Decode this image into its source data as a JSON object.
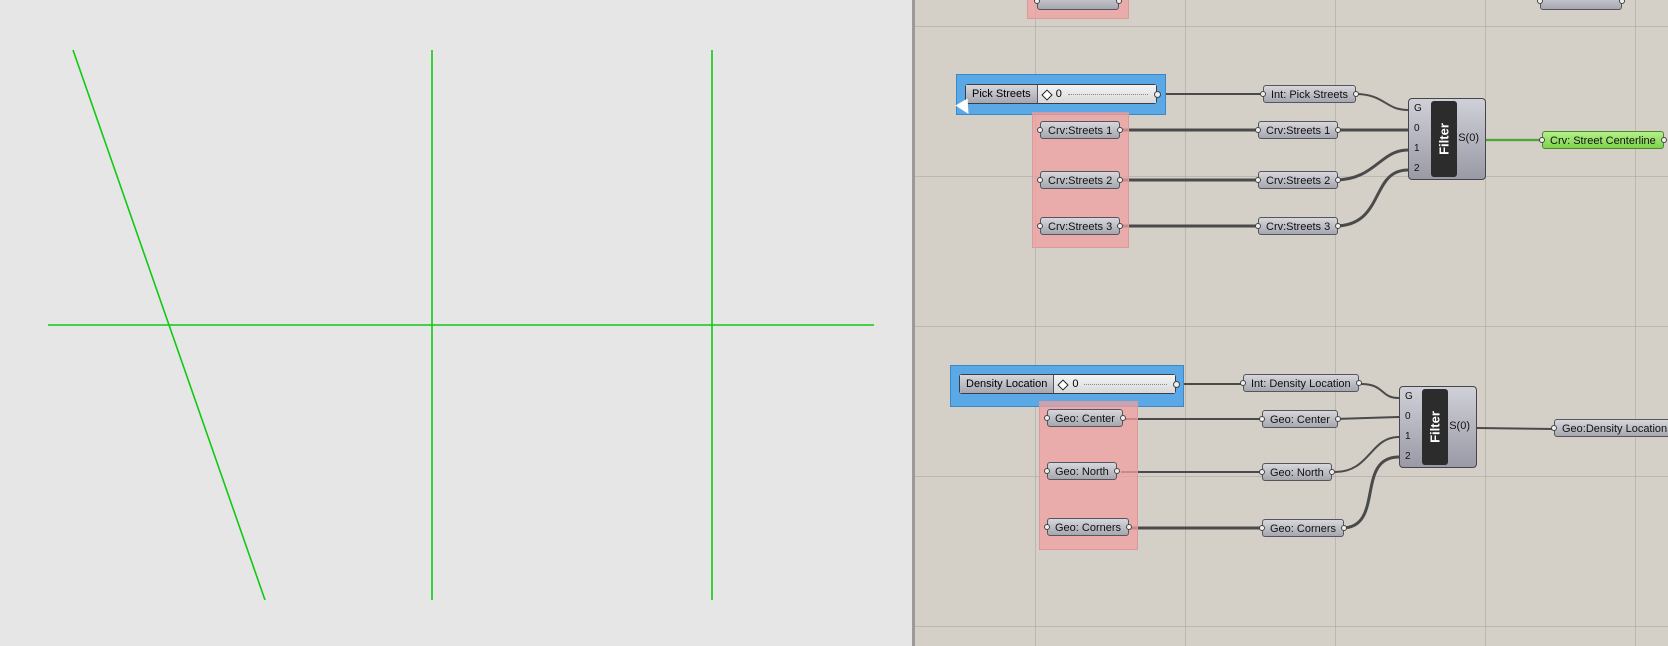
{
  "viewport": {
    "background": "#e6e6e6",
    "line_color": "#12c912"
  },
  "canvas": {
    "background": "#d4d0c8",
    "wire_color": "#4a4a4a",
    "highlight_wire_color": "#7ce05a",
    "red_group_color": "#f0a0a0",
    "blue_group_color": "#5aa8e6",
    "green_param_color": "#7cd34a"
  },
  "streets": {
    "slider_label": "Pick Streets",
    "slider_value": "0",
    "int_param": "Int: Pick Streets",
    "inputs": [
      "Crv:Streets 1",
      "Crv:Streets 2",
      "Crv:Streets 3"
    ],
    "relays": [
      "Crv:Streets 1",
      "Crv:Streets 2",
      "Crv:Streets 3"
    ],
    "filter": {
      "name": "Filter",
      "inputs": [
        "G",
        "0",
        "1",
        "2"
      ],
      "output": "S(0)"
    },
    "result": "Crv: Street Centerline"
  },
  "density": {
    "slider_label": "Density Location",
    "slider_value": "0",
    "int_param": "Int: Density Location",
    "inputs": [
      "Geo: Center",
      "Geo: North",
      "Geo: Corners"
    ],
    "relays": [
      "Geo: Center",
      "Geo: North",
      "Geo: Corners"
    ],
    "filter": {
      "name": "Filter",
      "inputs": [
        "G",
        "0",
        "1",
        "2"
      ],
      "output": "S(0)"
    },
    "result": "Geo:Density Location"
  }
}
